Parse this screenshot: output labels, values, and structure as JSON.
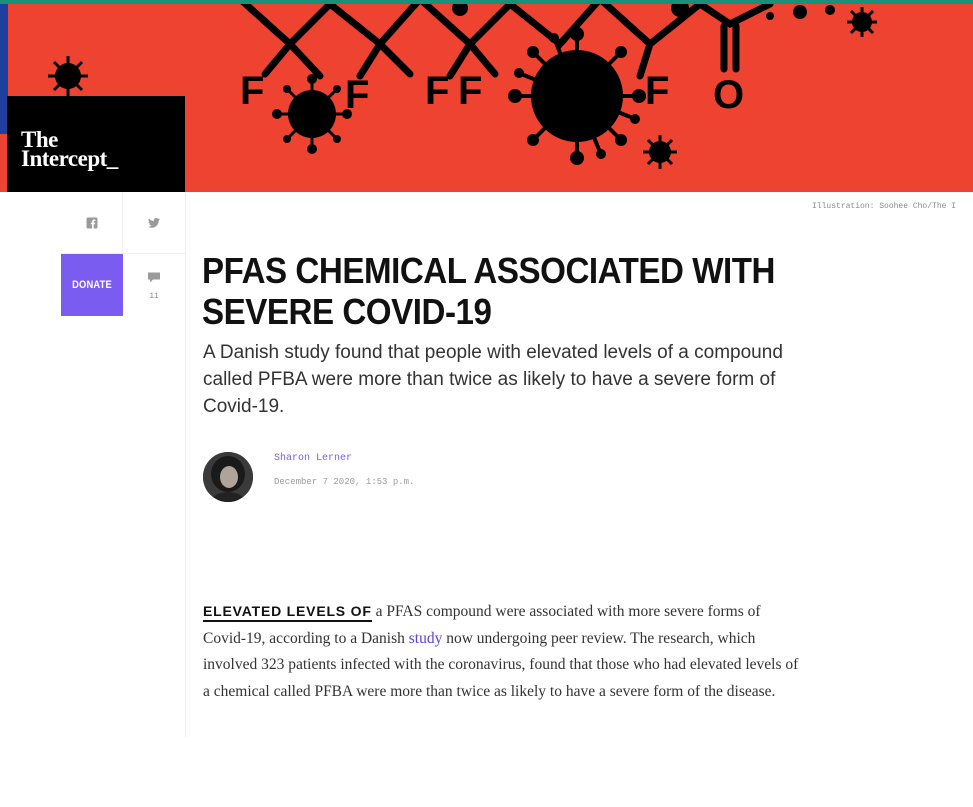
{
  "brand": {
    "logo_line1": "The",
    "logo_line2": "Intercept_",
    "accent_color": "#7a5cf0",
    "hero_color": "#ef4331"
  },
  "hero": {
    "molecule_labels": [
      "F",
      "F",
      "F",
      "F",
      "F",
      "O"
    ],
    "credit": "Illustration: Soohee Cho/The I"
  },
  "share": {
    "facebook_icon": "facebook-icon",
    "twitter_icon": "twitter-icon",
    "donate_label": "DONATE",
    "comment_icon": "comment-icon",
    "comment_count": "11"
  },
  "article": {
    "headline": "PFAS CHEMICAL ASSOCIATED WITH SEVERE COVID-19",
    "dek": "A Danish study found that people with elevated levels of a compound called PFBA were more than twice as likely to have a severe form of Covid-19.",
    "author": "Sharon Lerner",
    "date": "December 7 2020, 1:53 p.m.",
    "lead_in": "ELEVATED LEVELS OF",
    "body_before_link": " a PFAS compound were associated with more se­vere forms of Covid-19, according to a Danish ",
    "link_text": "study",
    "body_after_link": " now undergoing peer review. The research, which involved 323 patients infected with the coron­avirus, found that those who had elevated levels of a chemical called PFBA were more than twice as likely to have a severe form of the disease."
  }
}
